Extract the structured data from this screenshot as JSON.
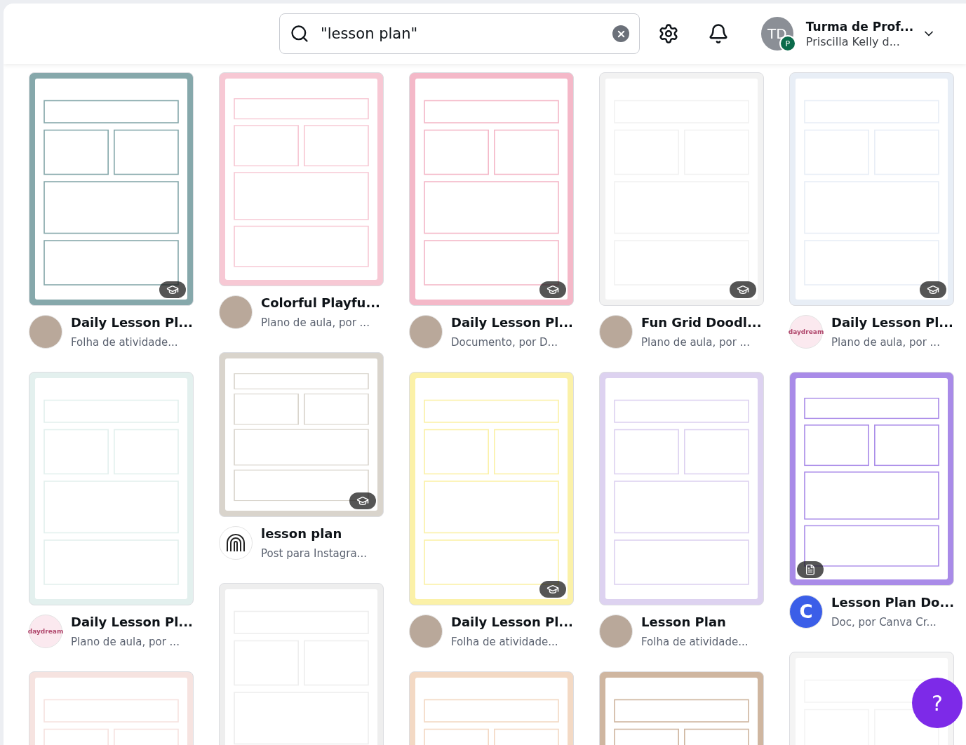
{
  "search": {
    "value": "\"lesson plan\""
  },
  "account": {
    "initials": "TD",
    "badge": "P",
    "name": "Turma de Prof...",
    "subtitle": "Priscilla Kelly d..."
  },
  "columns": [
    [
      {
        "kind": "tall",
        "color": "#86a8ab",
        "premium": true,
        "doc_icon": false,
        "avatar": {
          "kind": "photo"
        },
        "title": "Daily Lesson Pl...",
        "subtitle": "Folha de atividade..."
      },
      {
        "kind": "tall",
        "color": "#e3f0ee",
        "premium": false,
        "doc_icon": false,
        "avatar": {
          "kind": "logo",
          "text": "daydream"
        },
        "title": "Daily Lesson Pl...",
        "subtitle": "Plano de aula, por ..."
      },
      {
        "kind": "tall",
        "color": "#f6e3e0",
        "premium": false,
        "doc_icon": false
      }
    ],
    [
      {
        "kind": "medium",
        "color": "#f7c8d4",
        "premium": false,
        "doc_icon": false,
        "avatar": {
          "kind": "photo"
        },
        "title": "Colorful Playfu...",
        "subtitle": "Plano de aula, por ..."
      },
      {
        "kind": "square",
        "color": "#d9d4cc",
        "premium": true,
        "doc_icon": false,
        "avatar": {
          "kind": "fingerprint"
        },
        "title": "lesson plan",
        "subtitle": "Post para Instagra..."
      },
      {
        "kind": "tall",
        "color": "#eeeeee",
        "premium": false,
        "doc_icon": false
      }
    ],
    [
      {
        "kind": "tall",
        "color": "#f4b8c8",
        "premium": true,
        "doc_icon": false,
        "avatar": {
          "kind": "photo"
        },
        "title": "Daily Lesson Pl...",
        "subtitle": "Documento, por D..."
      },
      {
        "kind": "tall",
        "color": "#fbf1a8",
        "premium": true,
        "doc_icon": false,
        "avatar": {
          "kind": "photo"
        },
        "title": "Daily Lesson Pl...",
        "subtitle": "Folha de atividade..."
      },
      {
        "kind": "tall",
        "color": "#f3d9c4",
        "premium": false,
        "doc_icon": false
      }
    ],
    [
      {
        "kind": "tall",
        "color": "#f2f2f2",
        "premium": true,
        "doc_icon": false,
        "avatar": {
          "kind": "photo"
        },
        "title": "Fun Grid Doodl...",
        "subtitle": "Plano de aula, por ..."
      },
      {
        "kind": "tall",
        "color": "#ddd2f0",
        "premium": false,
        "doc_icon": false,
        "avatar": {
          "kind": "photo"
        },
        "title": "Lesson Plan",
        "subtitle": "Folha de atividade..."
      },
      {
        "kind": "tall",
        "color": "#cfb6a0",
        "premium": false,
        "doc_icon": false
      }
    ],
    [
      {
        "kind": "tall",
        "color": "#e8eef6",
        "premium": true,
        "doc_icon": false,
        "avatar": {
          "kind": "logo",
          "text": "daydream"
        },
        "title": "Daily Lesson Pl...",
        "subtitle": "Plano de aula, por ..."
      },
      {
        "kind": "medium",
        "color": "#a98be8",
        "premium": false,
        "doc_icon": true,
        "avatar": {
          "kind": "logo",
          "text": "C"
        },
        "title": "Lesson Plan Do...",
        "subtitle": "Doc, por Canva Cr..."
      },
      {
        "kind": "tall",
        "color": "#f4f4f4",
        "premium": false,
        "doc_icon": false
      }
    ]
  ],
  "help": {
    "label": "?"
  }
}
